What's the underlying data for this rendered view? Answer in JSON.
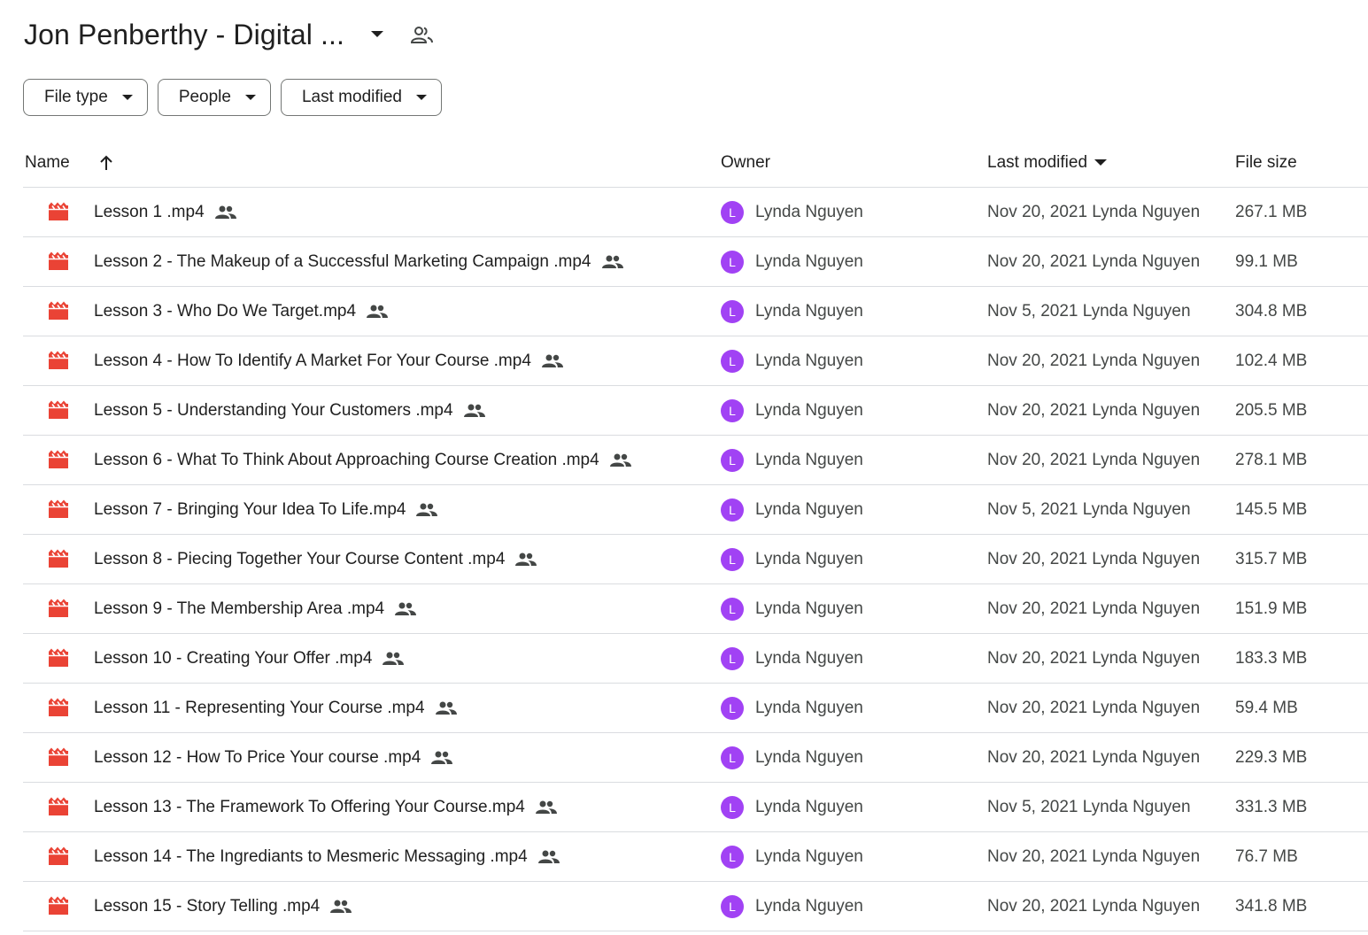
{
  "header": {
    "title": "Jon Penberthy - Digital ...",
    "caret_icon": "arrow-drop-down-icon",
    "shared_icon": "shared-folder-icon"
  },
  "filters": [
    {
      "label": "File type"
    },
    {
      "label": "People"
    },
    {
      "label": "Last modified"
    }
  ],
  "table": {
    "columns": {
      "name": "Name",
      "owner": "Owner",
      "last_modified": "Last modified",
      "file_size": "File size"
    },
    "sort": {
      "column": "Name",
      "direction": "ascending"
    },
    "rows": [
      {
        "name": "Lesson 1 .mp4",
        "owner_initial": "L",
        "owner": "Lynda Nguyen",
        "modified": "Nov 20, 2021 Lynda Nguyen",
        "size": "267.1 MB"
      },
      {
        "name": "Lesson 2 - The Makeup of a Successful Marketing Campaign .mp4",
        "owner_initial": "L",
        "owner": "Lynda Nguyen",
        "modified": "Nov 20, 2021 Lynda Nguyen",
        "size": "99.1 MB"
      },
      {
        "name": "Lesson 3 - Who Do We Target.mp4",
        "owner_initial": "L",
        "owner": "Lynda Nguyen",
        "modified": "Nov 5, 2021 Lynda Nguyen",
        "size": "304.8 MB"
      },
      {
        "name": "Lesson 4 - How To Identify A Market For Your Course .mp4",
        "owner_initial": "L",
        "owner": "Lynda Nguyen",
        "modified": "Nov 20, 2021 Lynda Nguyen",
        "size": "102.4 MB"
      },
      {
        "name": "Lesson 5 - Understanding Your Customers .mp4",
        "owner_initial": "L",
        "owner": "Lynda Nguyen",
        "modified": "Nov 20, 2021 Lynda Nguyen",
        "size": "205.5 MB"
      },
      {
        "name": "Lesson 6 - What To Think About Approaching Course Creation .mp4",
        "owner_initial": "L",
        "owner": "Lynda Nguyen",
        "modified": "Nov 20, 2021 Lynda Nguyen",
        "size": "278.1 MB"
      },
      {
        "name": "Lesson 7 - Bringing Your Idea To Life.mp4",
        "owner_initial": "L",
        "owner": "Lynda Nguyen",
        "modified": "Nov 5, 2021 Lynda Nguyen",
        "size": "145.5 MB"
      },
      {
        "name": "Lesson 8 - Piecing Together Your Course Content .mp4",
        "owner_initial": "L",
        "owner": "Lynda Nguyen",
        "modified": "Nov 20, 2021 Lynda Nguyen",
        "size": "315.7 MB"
      },
      {
        "name": "Lesson 9 - The Membership Area .mp4",
        "owner_initial": "L",
        "owner": "Lynda Nguyen",
        "modified": "Nov 20, 2021 Lynda Nguyen",
        "size": "151.9 MB"
      },
      {
        "name": "Lesson 10 - Creating Your Offer .mp4",
        "owner_initial": "L",
        "owner": "Lynda Nguyen",
        "modified": "Nov 20, 2021 Lynda Nguyen",
        "size": "183.3 MB"
      },
      {
        "name": "Lesson 11 - Representing Your Course .mp4",
        "owner_initial": "L",
        "owner": "Lynda Nguyen",
        "modified": "Nov 20, 2021 Lynda Nguyen",
        "size": "59.4 MB"
      },
      {
        "name": "Lesson 12 - How To Price Your course .mp4",
        "owner_initial": "L",
        "owner": "Lynda Nguyen",
        "modified": "Nov 20, 2021 Lynda Nguyen",
        "size": "229.3 MB"
      },
      {
        "name": "Lesson 13 - The Framework To Offering Your Course.mp4",
        "owner_initial": "L",
        "owner": "Lynda Nguyen",
        "modified": "Nov 5, 2021 Lynda Nguyen",
        "size": "331.3 MB"
      },
      {
        "name": "Lesson 14 - The Ingrediants to Mesmeric Messaging .mp4",
        "owner_initial": "L",
        "owner": "Lynda Nguyen",
        "modified": "Nov 20, 2021 Lynda Nguyen",
        "size": "76.7 MB"
      },
      {
        "name": "Lesson 15 - Story Telling .mp4",
        "owner_initial": "L",
        "owner": "Lynda Nguyen",
        "modified": "Nov 20, 2021 Lynda Nguyen",
        "size": "341.8 MB"
      }
    ]
  },
  "colors": {
    "video_icon": "#ea4335",
    "avatar": "#a142f4",
    "divider": "#dadce0",
    "secondary_text": "#444746"
  }
}
